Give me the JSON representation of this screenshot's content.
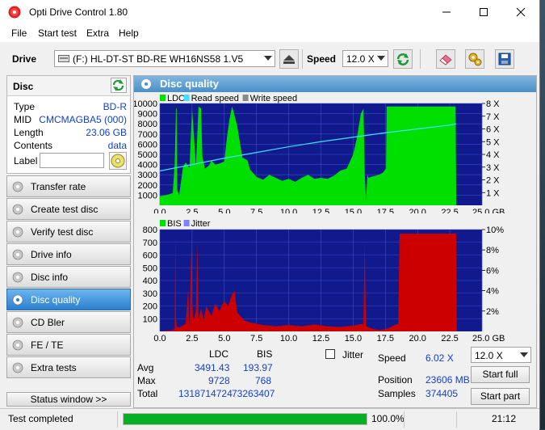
{
  "window": {
    "title": "Opti Drive Control 1.80"
  },
  "menu": [
    "File",
    "Start test",
    "Extra",
    "Help"
  ],
  "toolbar": {
    "drive_label": "Drive",
    "drive_value": "(F:)   HL-DT-ST BD-RE  WH16NS58 1.V5",
    "speed_label": "Speed",
    "speed_value": "12.0 X"
  },
  "disc": {
    "header": "Disc",
    "rows": [
      {
        "label": "Type",
        "value": "BD-R"
      },
      {
        "label": "MID",
        "value": "CMCMAGBA5 (000)"
      },
      {
        "label": "Length",
        "value": "23.06 GB"
      },
      {
        "label": "Contents",
        "value": "data"
      }
    ],
    "label_field": "Label",
    "label_value": ""
  },
  "nav": [
    {
      "label": "Transfer rate",
      "active": false
    },
    {
      "label": "Create test disc",
      "active": false
    },
    {
      "label": "Verify test disc",
      "active": false
    },
    {
      "label": "Drive info",
      "active": false
    },
    {
      "label": "Disc info",
      "active": false
    },
    {
      "label": "Disc quality",
      "active": true
    },
    {
      "label": "CD Bler",
      "active": false
    },
    {
      "label": "FE / TE",
      "active": false
    },
    {
      "label": "Extra tests",
      "active": false
    }
  ],
  "status_window_btn": "Status window >>",
  "panel_title": "Disc quality",
  "colors": {
    "ldc": "#00e000",
    "bis": "#cc0000",
    "read_speed": "#40e0ff",
    "write_speed": "#8a8a8a",
    "plot_bg": "#101a8c",
    "grid": "#3b4cc8",
    "accent": "#2a7fd0"
  },
  "chart_data": [
    {
      "type": "area",
      "legend": [
        "LDC",
        "Read speed",
        "Write speed"
      ],
      "x_ticks": [
        "0.0",
        "2.5",
        "5.0",
        "7.5",
        "10.0",
        "12.5",
        "15.0",
        "17.5",
        "20.0",
        "22.5",
        "25.0 GB"
      ],
      "xlim": [
        0,
        25
      ],
      "y_ticks": [
        "1000",
        "2000",
        "3000",
        "4000",
        "5000",
        "6000",
        "7000",
        "8000",
        "9000",
        "10000"
      ],
      "ylim": [
        0,
        10000
      ],
      "y2_ticks": [
        "1 X",
        "2 X",
        "3 X",
        "4 X",
        "5 X",
        "6 X",
        "7 X",
        "8 X"
      ],
      "y2lim": [
        0,
        8
      ],
      "ldc_x": [
        0,
        0.5,
        1.0,
        1.15,
        1.25,
        1.3,
        1.35,
        1.5,
        1.8,
        2.0,
        2.3,
        2.5,
        2.8,
        3.0,
        3.2,
        3.3,
        3.5,
        3.8,
        4.0,
        4.3,
        4.6,
        5.0,
        5.2,
        5.4,
        5.6,
        5.7,
        6.0,
        6.4,
        6.8,
        7.0,
        7.5,
        8.0,
        8.5,
        9.0,
        9.5,
        10.0,
        10.5,
        11.0,
        11.5,
        12.0,
        12.5,
        13.0,
        13.5,
        14.0,
        14.5,
        15.0,
        15.3,
        15.6,
        15.8,
        15.9,
        16.0,
        16.1,
        16.2,
        16.4,
        16.7,
        17.0,
        17.3,
        17.55,
        17.6,
        17.7,
        20.0,
        22.5,
        22.95,
        23.0
      ],
      "ldc_y": [
        900,
        1000,
        1200,
        4000,
        9500,
        9500,
        1500,
        1000,
        3800,
        4200,
        3700,
        9500,
        3900,
        9700,
        9500,
        4800,
        3600,
        3900,
        4400,
        4000,
        4100,
        4300,
        6600,
        8400,
        9700,
        9300,
        7800,
        4700,
        4400,
        3500,
        2800,
        2500,
        3000,
        2700,
        2400,
        2600,
        2300,
        2700,
        3000,
        2600,
        2700,
        2600,
        2900,
        3400,
        3600,
        5000,
        6700,
        9000,
        9500,
        3100,
        400,
        3000,
        2700,
        2800,
        2900,
        3000,
        3200,
        3600,
        9700,
        9700,
        9700,
        9700,
        9700,
        0
      ],
      "read_speed_x": [
        0,
        2.5,
        5,
        7.5,
        10,
        12.5,
        15,
        17.5,
        20,
        22.5,
        23.0
      ],
      "read_speed_y": [
        2.7,
        3.2,
        3.7,
        4.15,
        4.6,
        5.0,
        5.35,
        5.7,
        6.0,
        6.3,
        6.4
      ]
    },
    {
      "type": "area",
      "legend": [
        "BIS",
        "Jitter"
      ],
      "x_ticks": [
        "0.0",
        "2.5",
        "5.0",
        "7.5",
        "10.0",
        "12.5",
        "15.0",
        "17.5",
        "20.0",
        "22.5",
        "25.0 GB"
      ],
      "xlim": [
        0,
        25
      ],
      "y_ticks": [
        "100",
        "200",
        "300",
        "400",
        "500",
        "600",
        "700",
        "800"
      ],
      "ylim": [
        0,
        800
      ],
      "y2_ticks": [
        "2%",
        "4%",
        "6%",
        "8%",
        "10%"
      ],
      "y2lim": [
        0,
        10
      ],
      "bis_x": [
        0,
        1.0,
        1.15,
        1.2,
        1.25,
        1.3,
        1.5,
        2.0,
        2.2,
        2.3,
        2.45,
        2.5,
        2.6,
        2.8,
        2.9,
        3.0,
        3.2,
        3.4,
        3.6,
        4.0,
        4.3,
        4.6,
        5.0,
        5.3,
        5.6,
        5.8,
        6.0,
        6.5,
        7.0,
        7.5,
        8.0,
        9.0,
        10.0,
        11.0,
        12.0,
        13.0,
        14.0,
        15.0,
        15.8,
        15.9,
        16.0,
        16.5,
        17.0,
        17.6,
        18.0,
        18.5,
        18.6,
        23.0,
        23.05
      ],
      "bis_y": [
        0,
        10,
        20,
        768,
        120,
        40,
        30,
        60,
        330,
        40,
        700,
        250,
        80,
        160,
        700,
        100,
        180,
        90,
        200,
        120,
        220,
        160,
        240,
        200,
        290,
        320,
        150,
        90,
        70,
        60,
        50,
        40,
        50,
        40,
        55,
        40,
        35,
        45,
        60,
        700,
        40,
        20,
        10,
        20,
        40,
        60,
        768,
        768,
        0
      ]
    }
  ],
  "stats": {
    "col_ldc": "LDC",
    "col_bis": "BIS",
    "avg_label": "Avg",
    "avg_ldc": "3491.43",
    "avg_bis": "193.97",
    "max_label": "Max",
    "max_ldc": "9728",
    "max_bis": "768",
    "total_label": "Total",
    "total_ldc": "1318714724",
    "total_bis": "73263407",
    "jitter_label": "Jitter",
    "speed_label": "Speed",
    "speed_value": "6.02 X",
    "position_label": "Position",
    "position_value": "23606 MB",
    "samples_label": "Samples",
    "samples_value": "374405",
    "speed_select": "12.0 X",
    "start_full": "Start full",
    "start_part": "Start part"
  },
  "statusbar": {
    "text": "Test completed",
    "progress": 100,
    "progress_text": "100.0%",
    "time": "21:12"
  }
}
